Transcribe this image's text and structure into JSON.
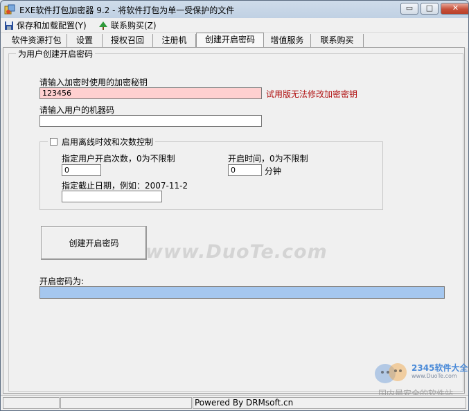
{
  "window": {
    "title": "EXE软件打包加密器 9.2 - 将软件打包为单一受保护的文件",
    "buttons": {
      "minimize": "▭",
      "maximize": "□",
      "close": "✕"
    }
  },
  "menu": {
    "items": [
      {
        "label": "保存和加载配置(Y)",
        "icon": "save-disk-icon"
      },
      {
        "label": "联系购买(Z)",
        "icon": "tree-icon"
      }
    ]
  },
  "tabs": [
    {
      "label": "软件资源打包",
      "active": false
    },
    {
      "label": "设置",
      "active": false
    },
    {
      "label": "授权召回",
      "active": false
    },
    {
      "label": "注册机",
      "active": false
    },
    {
      "label": "创建开启密码",
      "active": true
    },
    {
      "label": "增值服务",
      "active": false
    },
    {
      "label": "联系购买",
      "active": false
    }
  ],
  "panel": {
    "group_title": "为用户创建开启密码",
    "key_label": "请输入加密时使用的加密秘钥",
    "key_value": "123456",
    "key_warning": "试用版无法修改加密密钥",
    "machine_label": "请输入用户的机器码",
    "machine_value": "",
    "offline": {
      "checkbox_label": "启用离线时效和次数控制",
      "checked": false,
      "count_label": "指定用户开启次数，0为不限制",
      "count_value": "0",
      "time_label": "开启时间，0为不限制",
      "time_value": "0",
      "time_unit": "分钟",
      "date_label": "指定截止日期，例如：2007-11-2",
      "date_value": ""
    },
    "create_button": "创建开启密码",
    "result_label": "开启密码为:",
    "result_value": ""
  },
  "watermark": {
    "text": "www.DuoTe.com",
    "badge_brand": "2345软件大全",
    "badge_url": "www.DuoTe.com",
    "badge_slogan": "国内最安全的软件站"
  },
  "statusbar": {
    "text": "Powered By DRMsoft.cn"
  },
  "colors": {
    "title_gradient_top": "#cfdcea",
    "key_field_bg": "#ffd0d0",
    "warning_text": "#b01010",
    "result_bar_bg": "#a5c7ef"
  }
}
